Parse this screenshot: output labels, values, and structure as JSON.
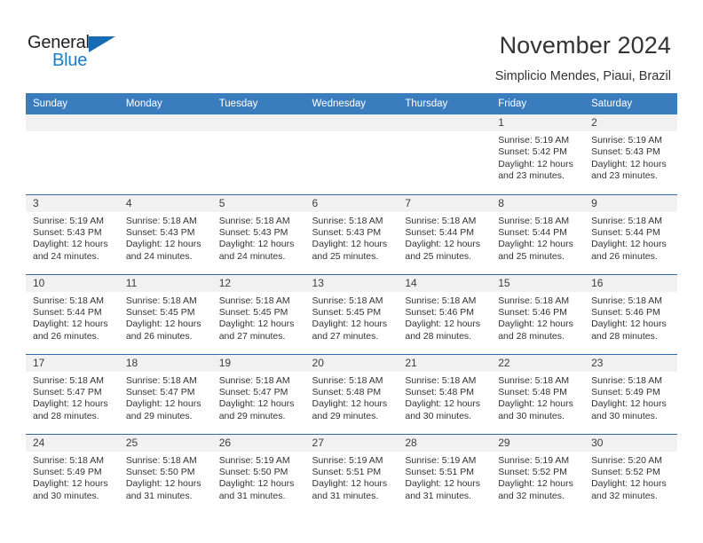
{
  "brand": {
    "name_part1": "General",
    "name_part2": "Blue"
  },
  "header": {
    "title": "November 2024",
    "subtitle": "Simplicio Mendes, Piaui, Brazil"
  },
  "colors": {
    "header_blue": "#3a7dbf",
    "row_divider": "#2f6ca8",
    "daynum_band": "#f1f1f1",
    "brand_blue": "#1a7dc4",
    "text": "#333333"
  },
  "calendar": {
    "weekday_headers": [
      "Sunday",
      "Monday",
      "Tuesday",
      "Wednesday",
      "Thursday",
      "Friday",
      "Saturday"
    ],
    "weeks": [
      [
        {
          "day": "",
          "blank": true
        },
        {
          "day": "",
          "blank": true
        },
        {
          "day": "",
          "blank": true
        },
        {
          "day": "",
          "blank": true
        },
        {
          "day": "",
          "blank": true
        },
        {
          "day": "1",
          "sunrise": "Sunrise: 5:19 AM",
          "sunset": "Sunset: 5:42 PM",
          "daylight": "Daylight: 12 hours and 23 minutes."
        },
        {
          "day": "2",
          "sunrise": "Sunrise: 5:19 AM",
          "sunset": "Sunset: 5:43 PM",
          "daylight": "Daylight: 12 hours and 23 minutes."
        }
      ],
      [
        {
          "day": "3",
          "sunrise": "Sunrise: 5:19 AM",
          "sunset": "Sunset: 5:43 PM",
          "daylight": "Daylight: 12 hours and 24 minutes."
        },
        {
          "day": "4",
          "sunrise": "Sunrise: 5:18 AM",
          "sunset": "Sunset: 5:43 PM",
          "daylight": "Daylight: 12 hours and 24 minutes."
        },
        {
          "day": "5",
          "sunrise": "Sunrise: 5:18 AM",
          "sunset": "Sunset: 5:43 PM",
          "daylight": "Daylight: 12 hours and 24 minutes."
        },
        {
          "day": "6",
          "sunrise": "Sunrise: 5:18 AM",
          "sunset": "Sunset: 5:43 PM",
          "daylight": "Daylight: 12 hours and 25 minutes."
        },
        {
          "day": "7",
          "sunrise": "Sunrise: 5:18 AM",
          "sunset": "Sunset: 5:44 PM",
          "daylight": "Daylight: 12 hours and 25 minutes."
        },
        {
          "day": "8",
          "sunrise": "Sunrise: 5:18 AM",
          "sunset": "Sunset: 5:44 PM",
          "daylight": "Daylight: 12 hours and 25 minutes."
        },
        {
          "day": "9",
          "sunrise": "Sunrise: 5:18 AM",
          "sunset": "Sunset: 5:44 PM",
          "daylight": "Daylight: 12 hours and 26 minutes."
        }
      ],
      [
        {
          "day": "10",
          "sunrise": "Sunrise: 5:18 AM",
          "sunset": "Sunset: 5:44 PM",
          "daylight": "Daylight: 12 hours and 26 minutes."
        },
        {
          "day": "11",
          "sunrise": "Sunrise: 5:18 AM",
          "sunset": "Sunset: 5:45 PM",
          "daylight": "Daylight: 12 hours and 26 minutes."
        },
        {
          "day": "12",
          "sunrise": "Sunrise: 5:18 AM",
          "sunset": "Sunset: 5:45 PM",
          "daylight": "Daylight: 12 hours and 27 minutes."
        },
        {
          "day": "13",
          "sunrise": "Sunrise: 5:18 AM",
          "sunset": "Sunset: 5:45 PM",
          "daylight": "Daylight: 12 hours and 27 minutes."
        },
        {
          "day": "14",
          "sunrise": "Sunrise: 5:18 AM",
          "sunset": "Sunset: 5:46 PM",
          "daylight": "Daylight: 12 hours and 28 minutes."
        },
        {
          "day": "15",
          "sunrise": "Sunrise: 5:18 AM",
          "sunset": "Sunset: 5:46 PM",
          "daylight": "Daylight: 12 hours and 28 minutes."
        },
        {
          "day": "16",
          "sunrise": "Sunrise: 5:18 AM",
          "sunset": "Sunset: 5:46 PM",
          "daylight": "Daylight: 12 hours and 28 minutes."
        }
      ],
      [
        {
          "day": "17",
          "sunrise": "Sunrise: 5:18 AM",
          "sunset": "Sunset: 5:47 PM",
          "daylight": "Daylight: 12 hours and 28 minutes."
        },
        {
          "day": "18",
          "sunrise": "Sunrise: 5:18 AM",
          "sunset": "Sunset: 5:47 PM",
          "daylight": "Daylight: 12 hours and 29 minutes."
        },
        {
          "day": "19",
          "sunrise": "Sunrise: 5:18 AM",
          "sunset": "Sunset: 5:47 PM",
          "daylight": "Daylight: 12 hours and 29 minutes."
        },
        {
          "day": "20",
          "sunrise": "Sunrise: 5:18 AM",
          "sunset": "Sunset: 5:48 PM",
          "daylight": "Daylight: 12 hours and 29 minutes."
        },
        {
          "day": "21",
          "sunrise": "Sunrise: 5:18 AM",
          "sunset": "Sunset: 5:48 PM",
          "daylight": "Daylight: 12 hours and 30 minutes."
        },
        {
          "day": "22",
          "sunrise": "Sunrise: 5:18 AM",
          "sunset": "Sunset: 5:48 PM",
          "daylight": "Daylight: 12 hours and 30 minutes."
        },
        {
          "day": "23",
          "sunrise": "Sunrise: 5:18 AM",
          "sunset": "Sunset: 5:49 PM",
          "daylight": "Daylight: 12 hours and 30 minutes."
        }
      ],
      [
        {
          "day": "24",
          "sunrise": "Sunrise: 5:18 AM",
          "sunset": "Sunset: 5:49 PM",
          "daylight": "Daylight: 12 hours and 30 minutes."
        },
        {
          "day": "25",
          "sunrise": "Sunrise: 5:18 AM",
          "sunset": "Sunset: 5:50 PM",
          "daylight": "Daylight: 12 hours and 31 minutes."
        },
        {
          "day": "26",
          "sunrise": "Sunrise: 5:19 AM",
          "sunset": "Sunset: 5:50 PM",
          "daylight": "Daylight: 12 hours and 31 minutes."
        },
        {
          "day": "27",
          "sunrise": "Sunrise: 5:19 AM",
          "sunset": "Sunset: 5:51 PM",
          "daylight": "Daylight: 12 hours and 31 minutes."
        },
        {
          "day": "28",
          "sunrise": "Sunrise: 5:19 AM",
          "sunset": "Sunset: 5:51 PM",
          "daylight": "Daylight: 12 hours and 31 minutes."
        },
        {
          "day": "29",
          "sunrise": "Sunrise: 5:19 AM",
          "sunset": "Sunset: 5:52 PM",
          "daylight": "Daylight: 12 hours and 32 minutes."
        },
        {
          "day": "30",
          "sunrise": "Sunrise: 5:20 AM",
          "sunset": "Sunset: 5:52 PM",
          "daylight": "Daylight: 12 hours and 32 minutes."
        }
      ]
    ]
  }
}
